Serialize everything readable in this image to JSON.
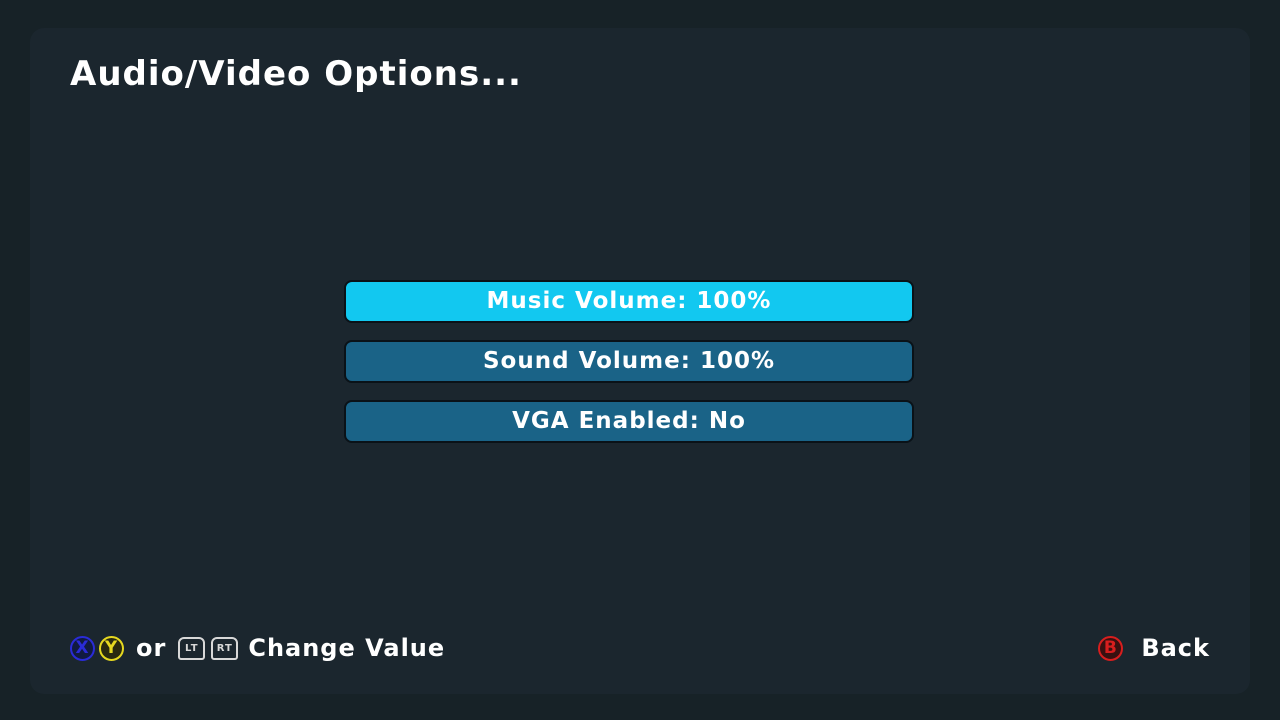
{
  "title": "Audio/Video Options...",
  "menu": {
    "items": [
      {
        "label": "Music Volume: 100%",
        "selected": true
      },
      {
        "label": "Sound Volume: 100%",
        "selected": false
      },
      {
        "label": "VGA Enabled: No",
        "selected": false
      }
    ]
  },
  "footer": {
    "left": {
      "x_button": "X",
      "y_button": "Y",
      "or_text": "or",
      "lt_button": "LT",
      "rt_button": "RT",
      "label": "Change Value"
    },
    "right": {
      "b_button": "B",
      "label": "Back"
    }
  },
  "colors": {
    "background": "#172227",
    "panel": "#1b262e",
    "item_normal": "#1a6387",
    "item_selected": "#12c8f0",
    "x_button": "#2a2bd8",
    "y_button": "#e6d820",
    "b_button": "#d81e1e"
  }
}
